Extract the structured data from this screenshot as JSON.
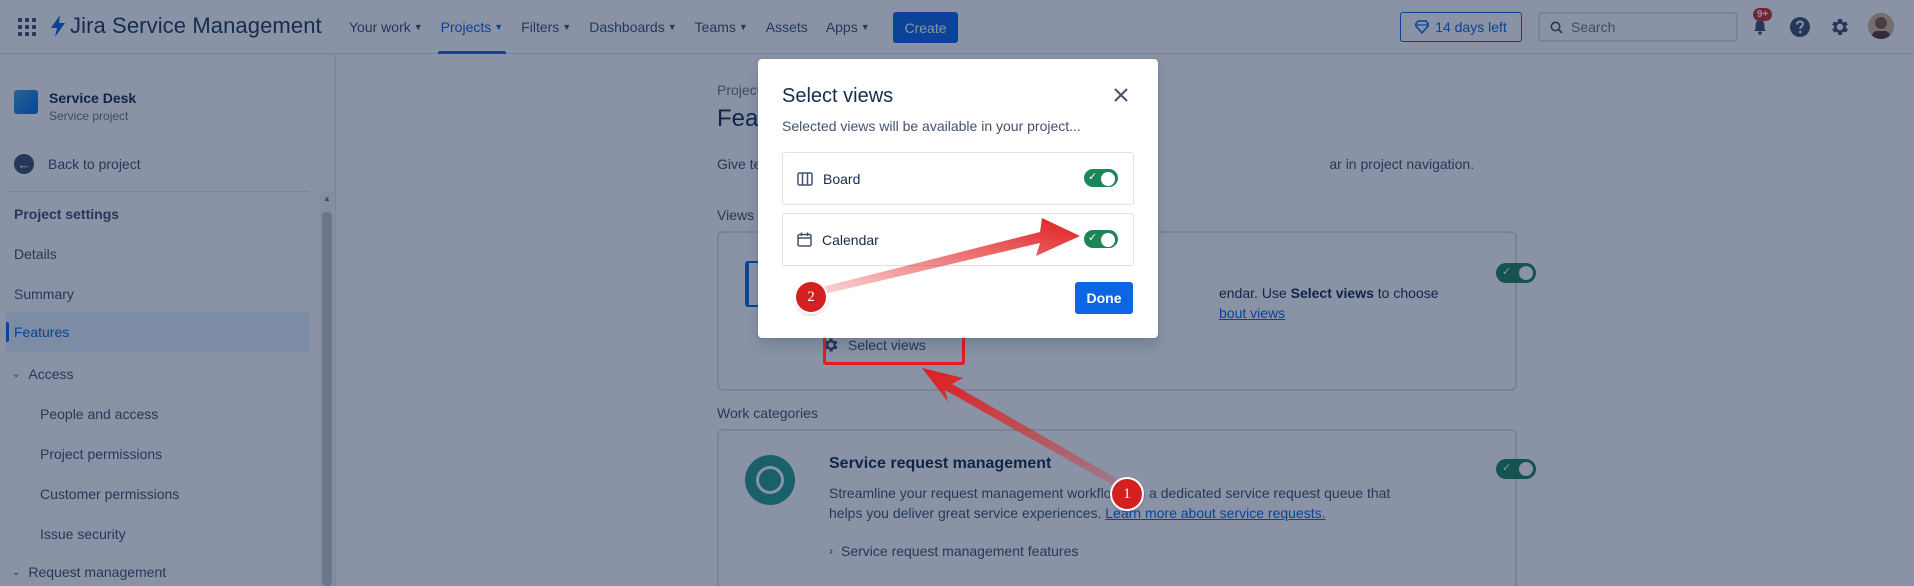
{
  "topnav": {
    "product": "Jira Service Management",
    "items": [
      {
        "label": "Your work",
        "chevron": true,
        "active": false
      },
      {
        "label": "Projects",
        "chevron": true,
        "active": true
      },
      {
        "label": "Filters",
        "chevron": true,
        "active": false
      },
      {
        "label": "Dashboards",
        "chevron": true,
        "active": false
      },
      {
        "label": "Teams",
        "chevron": true,
        "active": false
      },
      {
        "label": "Assets",
        "chevron": false,
        "active": false
      },
      {
        "label": "Apps",
        "chevron": true,
        "active": false
      }
    ],
    "create_label": "Create",
    "trial_label": "14 days left",
    "search_placeholder": "Search",
    "notification_badge": "9+"
  },
  "sidebar": {
    "project_name": "Service Desk",
    "project_type": "Service project",
    "back_label": "Back to project",
    "heading": "Project settings",
    "items": [
      {
        "label": "Details"
      },
      {
        "label": "Summary"
      },
      {
        "label": "Features"
      },
      {
        "label": "Access"
      },
      {
        "label": "People and access"
      },
      {
        "label": "Project permissions"
      },
      {
        "label": "Customer permissions"
      },
      {
        "label": "Issue security"
      },
      {
        "label": "Request management"
      }
    ]
  },
  "main": {
    "breadcrumb": "Project",
    "title": "Feat",
    "description": "Give te",
    "description_end": "ar in project navigation.",
    "views_section": "Views",
    "views_text_1a": "endar. Use ",
    "views_text_1b": "Select views",
    "views_text_1c": " to choose",
    "views_text_2": "bout views",
    "select_views_label": "Select views",
    "work_categories": "Work categories",
    "srm_title": "Service request management",
    "srm_desc_1": "Streamline your request management workflo",
    "srm_desc_1b": "th a dedicated service request queue that",
    "srm_desc_2": "helps you deliver great service experiences. ",
    "srm_link": "Learn more about service requests.",
    "srm_features": "Service request management features"
  },
  "modal": {
    "title": "Select views",
    "subtitle": "Selected views will be available in your project...",
    "views": [
      {
        "label": "Board",
        "enabled": true
      },
      {
        "label": "Calendar",
        "enabled": true
      }
    ],
    "done_label": "Done"
  },
  "annotations": {
    "step_1": "1",
    "step_2": "2"
  },
  "colors": {
    "accent": "#0c66e4",
    "toggle_on": "#1f845a",
    "annotation": "#e01e1e"
  }
}
